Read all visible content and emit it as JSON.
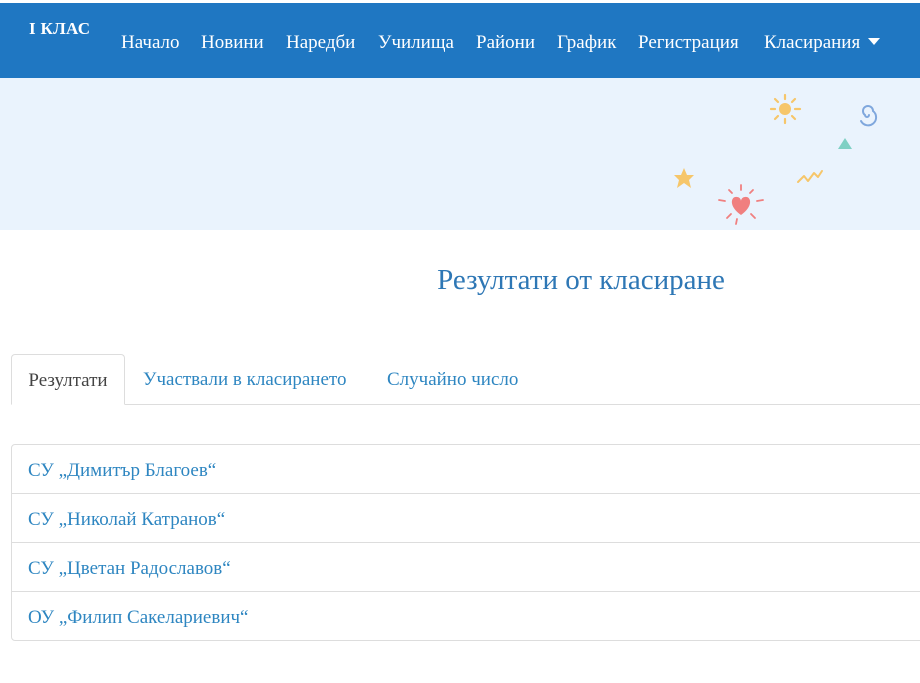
{
  "navbar": {
    "brand": "I КЛАС",
    "items": [
      {
        "label": "Начало"
      },
      {
        "label": "Новини"
      },
      {
        "label": "Наредби"
      },
      {
        "label": "Училища"
      },
      {
        "label": "Райони"
      },
      {
        "label": "График"
      },
      {
        "label": "Регистрация"
      },
      {
        "label": "Класирания"
      }
    ],
    "dropdown_icon": "caret-down-icon"
  },
  "banner": {
    "decorations": [
      "sun-icon",
      "spiral-icon",
      "triangle-icon",
      "star-icon",
      "zigzag-icon",
      "heart-icon"
    ]
  },
  "main": {
    "title": "Резултати от класиране",
    "tabs": [
      {
        "label": "Резултати",
        "active": true
      },
      {
        "label": "Участвали в класирането",
        "active": false
      },
      {
        "label": "Случайно число",
        "active": false
      }
    ],
    "schools": [
      {
        "name": "СУ „Димитър Благоев“"
      },
      {
        "name": "СУ „Николай Катранов“"
      },
      {
        "name": "СУ „Цветан Радославов“"
      },
      {
        "name": "ОУ „Филип Сакелариевич“"
      }
    ]
  },
  "colors": {
    "navbar": "#1f77c2",
    "banner": "#eaf3fd",
    "link": "#2e86c1",
    "title": "#2e77b5"
  }
}
